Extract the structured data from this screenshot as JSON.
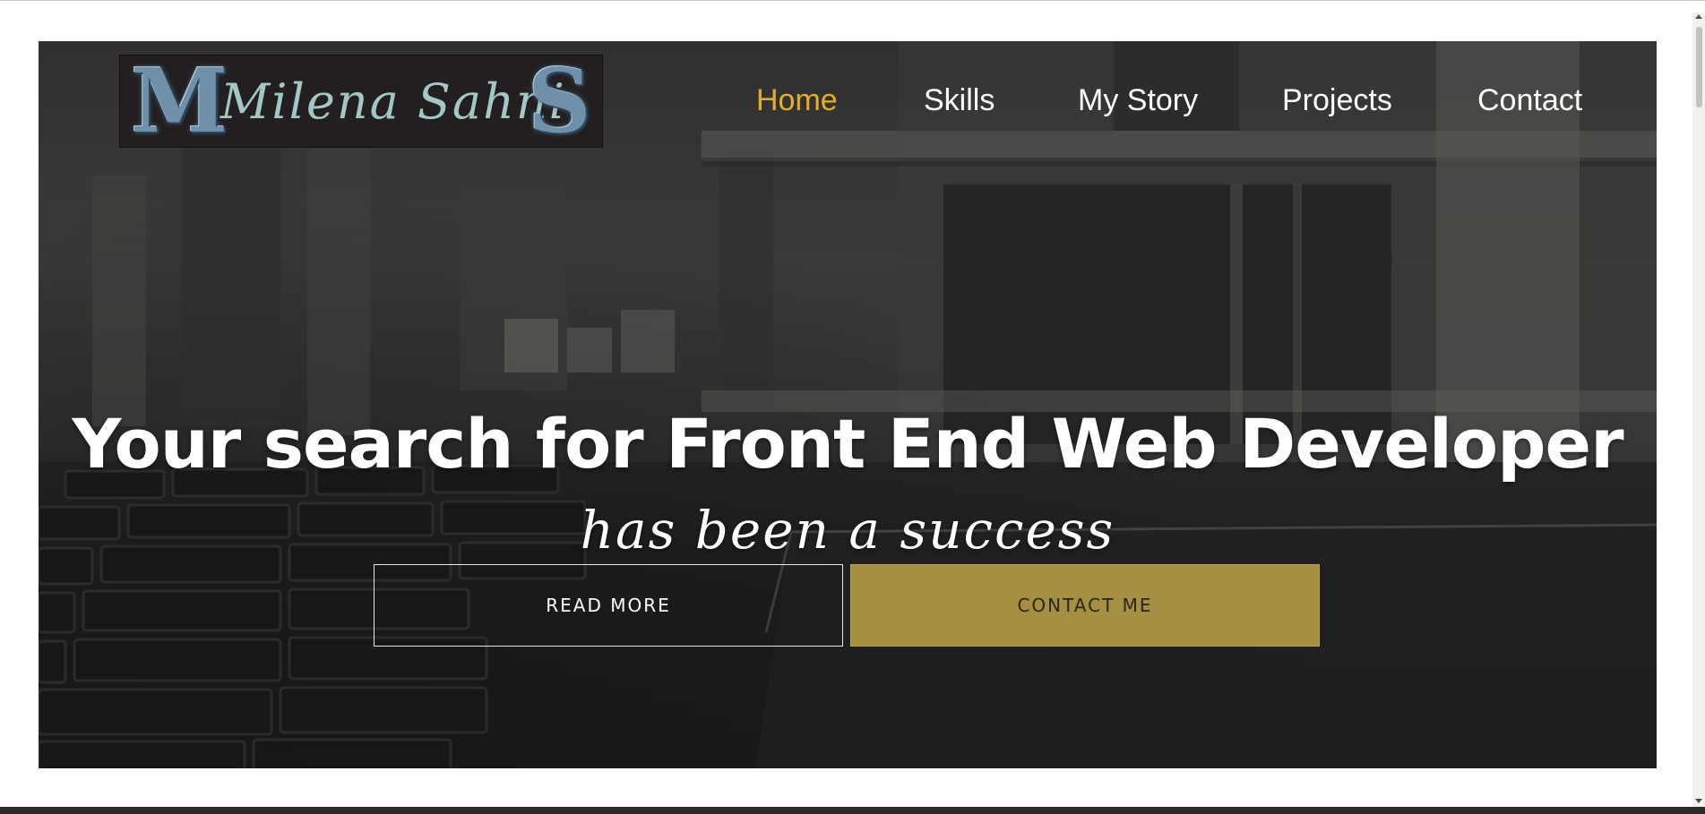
{
  "logo": {
    "initial_left": "M",
    "name": "Milena Sahni",
    "initial_right": "S"
  },
  "nav": {
    "items": [
      {
        "label": "Home",
        "active": true
      },
      {
        "label": "Skills",
        "active": false
      },
      {
        "label": "My Story",
        "active": false
      },
      {
        "label": "Projects",
        "active": false
      },
      {
        "label": "Contact",
        "active": false
      }
    ]
  },
  "hero": {
    "headline": "Your search for Front End Web Developer",
    "subheadline": "has been a success",
    "primary_button": "READ MORE",
    "secondary_button": "CONTACT ME"
  },
  "colors": {
    "accent": "#e5ad28",
    "button_fill": "#a48f42",
    "logo_bg": "#231f20",
    "logo_text": "#a3c7c4"
  },
  "icons": {
    "scroll_up": "scroll-up-arrow-icon",
    "scroll_down": "scroll-down-arrow-icon"
  }
}
